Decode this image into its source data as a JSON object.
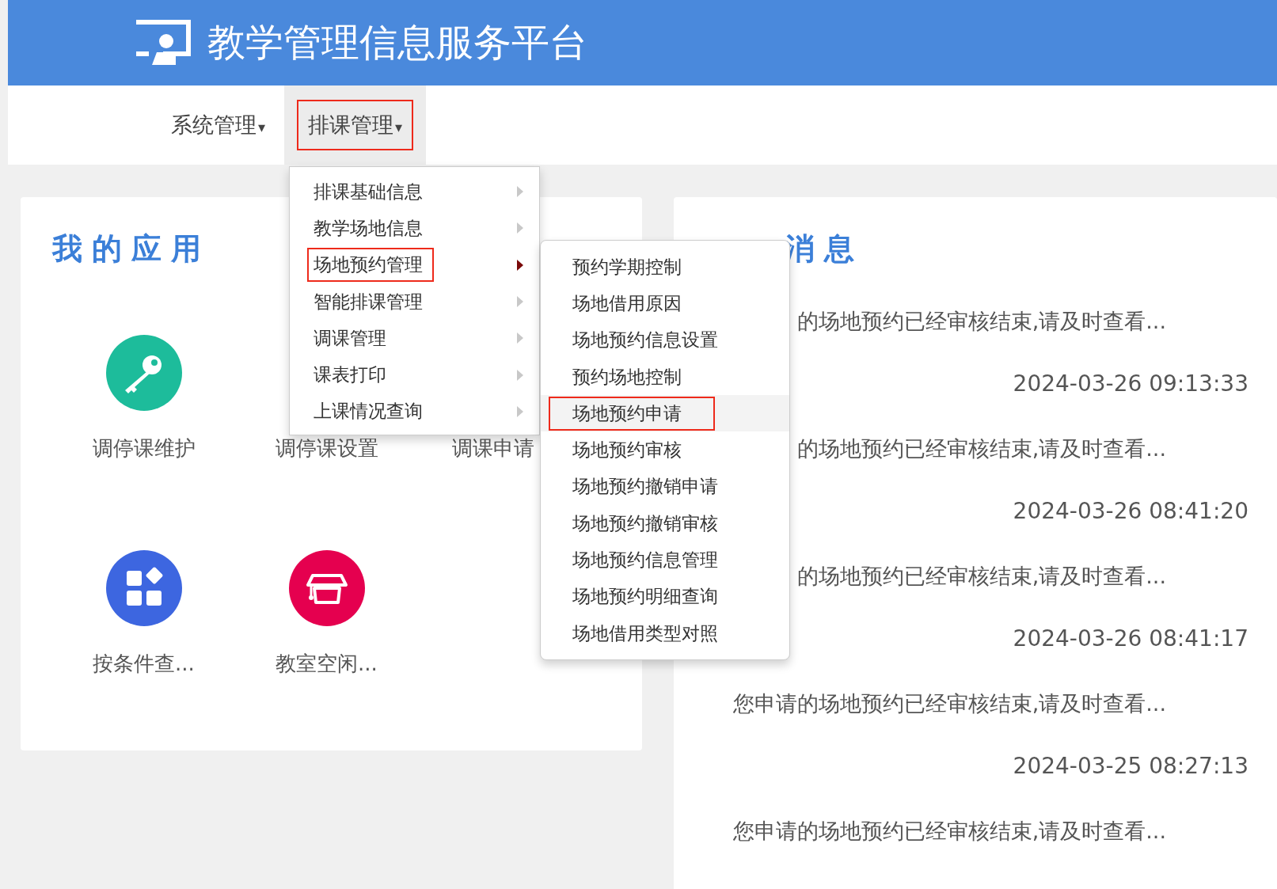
{
  "header": {
    "title": "教学管理信息服务平台"
  },
  "nav": [
    {
      "label": "系统管理",
      "caret": "▾",
      "selected": false,
      "annotated": false
    },
    {
      "label": "排课管理",
      "caret": "▾",
      "selected": true,
      "annotated": true
    }
  ],
  "apps_card": {
    "title": "我的应用",
    "apps": [
      {
        "label": "调停课维护",
        "kind": "key",
        "color": "#1dbc9b"
      },
      {
        "label": "调停课设置"
      },
      {
        "label": "调课申请"
      },
      {
        "label": "按条件查...",
        "kind": "grid",
        "color": "#3d66e0"
      },
      {
        "label": "教室空闲...",
        "kind": "cap",
        "color": "#e5004f"
      }
    ]
  },
  "messages_card": {
    "title": "消息",
    "messages": [
      {
        "text": "的场地预约已经审核结束,请及时查看...",
        "time": "2024-03-26 09:13:33"
      },
      {
        "text": "的场地预约已经审核结束,请及时查看...",
        "time": "2024-03-26 08:41:20"
      },
      {
        "text": "的场地预约已经审核结束,请及时查看...",
        "time": "2024-03-26 08:41:17"
      },
      {
        "text": "您申请的场地预约已经审核结束,请及时查看...",
        "time": "2024-03-25 08:27:13"
      },
      {
        "text": "您申请的场地预约已经审核结束,请及时查看..."
      }
    ]
  },
  "menu": [
    {
      "label": "排课基础信息",
      "expanded": false,
      "annotated": false
    },
    {
      "label": "教学场地信息",
      "expanded": false,
      "annotated": false
    },
    {
      "label": "场地预约管理",
      "expanded": true,
      "annotated": true
    },
    {
      "label": "智能排课管理",
      "expanded": false,
      "annotated": false
    },
    {
      "label": "调课管理",
      "expanded": false,
      "annotated": false
    },
    {
      "label": "课表打印",
      "expanded": false,
      "annotated": false
    },
    {
      "label": "上课情况查询",
      "expanded": false,
      "annotated": false
    }
  ],
  "submenu": [
    {
      "label": "预约学期控制",
      "selected": false,
      "annotated": false
    },
    {
      "label": "场地借用原因",
      "selected": false,
      "annotated": false
    },
    {
      "label": "场地预约信息设置",
      "selected": false,
      "annotated": false
    },
    {
      "label": "预约场地控制",
      "selected": false,
      "annotated": false
    },
    {
      "label": "场地预约申请",
      "selected": true,
      "annotated": true
    },
    {
      "label": "场地预约审核",
      "selected": false,
      "annotated": false
    },
    {
      "label": "场地预约撤销申请",
      "selected": false,
      "annotated": false
    },
    {
      "label": "场地预约撤销审核",
      "selected": false,
      "annotated": false
    },
    {
      "label": "场地预约信息管理",
      "selected": false,
      "annotated": false
    },
    {
      "label": "场地预约明细查询",
      "selected": false,
      "annotated": false
    },
    {
      "label": "场地借用类型对照",
      "selected": false,
      "annotated": false
    }
  ]
}
